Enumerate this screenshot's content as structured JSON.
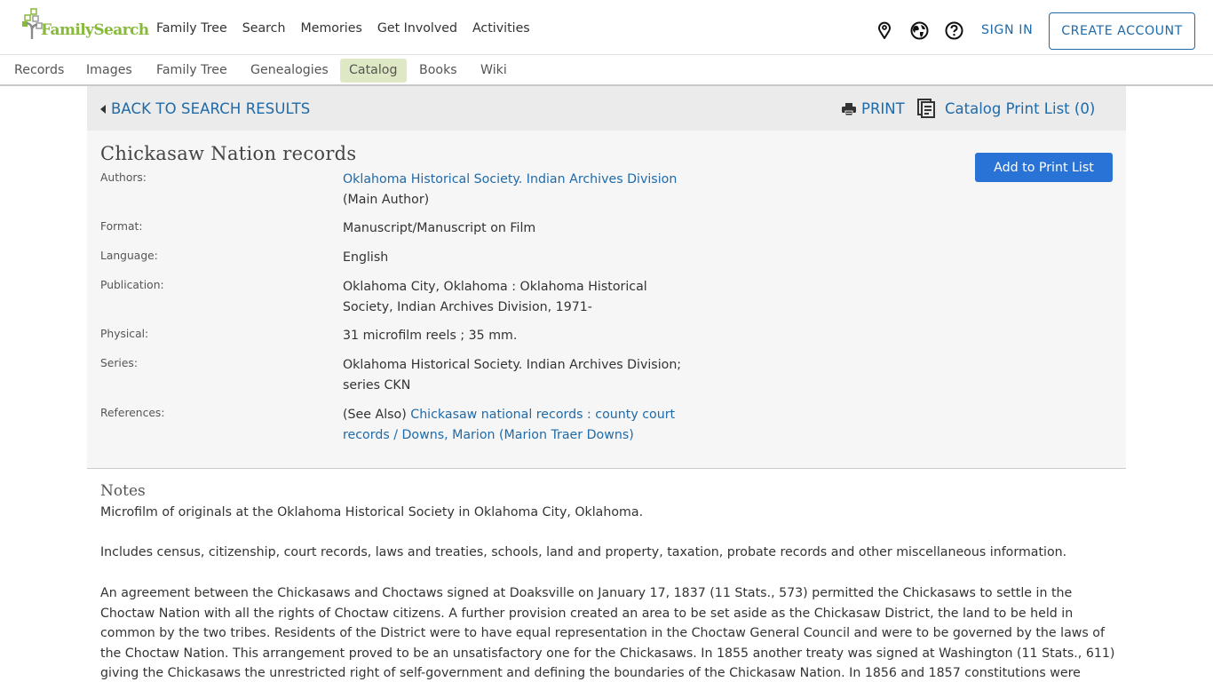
{
  "header": {
    "logo_text": "FamilySearch",
    "nav": [
      "Family Tree",
      "Search",
      "Memories",
      "Get Involved",
      "Activities"
    ],
    "icons": [
      "location-pin-icon",
      "globe-icon",
      "help-icon"
    ],
    "sign_in": "SIGN IN",
    "create_account": "CREATE ACCOUNT"
  },
  "subnav": {
    "items": [
      "Records",
      "Images",
      "Family Tree",
      "Genealogies",
      "Catalog",
      "Books",
      "Wiki"
    ],
    "active": "Catalog"
  },
  "toolbar": {
    "back": "BACK TO SEARCH RESULTS",
    "print": "PRINT",
    "print_list": "Catalog Print List (0)"
  },
  "record": {
    "title": "Chickasaw Nation records",
    "add_button": "Add to Print List",
    "fields": {
      "authors": {
        "label": "Authors:",
        "link": "Oklahoma Historical Society. Indian Archives Division",
        "role": "(Main Author)"
      },
      "format": {
        "label": "Format:",
        "value": "Manuscript/Manuscript on Film"
      },
      "language": {
        "label": "Language:",
        "value": "English"
      },
      "publication": {
        "label": "Publication:",
        "value": "Oklahoma City, Oklahoma : Oklahoma Historical Society, Indian Archives Division, 1971-"
      },
      "physical": {
        "label": "Physical:",
        "value": "31 microfilm reels ; 35 mm."
      },
      "series": {
        "label": "Series:",
        "value": "Oklahoma Historical Society. Indian Archives Division; series CKN"
      },
      "references": {
        "label": "References:",
        "prefix": "(See Also) ",
        "link": "Chickasaw national records : county court records / Downs, Marion (Marion Traer Downs)"
      }
    }
  },
  "notes": {
    "title": "Notes",
    "paragraphs": [
      "Microfilm of originals at the Oklahoma Historical Society in Oklahoma City, Oklahoma.",
      "Includes census, citizenship, court records, laws and treaties, schools, land and property, taxation, probate records and other miscellaneous information.",
      "An agreement between the Chickasaws and Choctaws signed at Doaksville on January 17, 1837 (11 Stats., 573) permitted the Chickasaws to settle in the Choctaw Nation with all the rights of Choctaw citizens. A further provision created an area to be set aside as the Chickasaw District, the land to be held in common by the two tribes. Residents of the District were to have equal representation in the Choctaw General Council and were to be governed by the laws of the Choctaw Nation. This arrangement proved to be an unsatisfactory one for the Chickasaws. In 1855 another treaty was signed at Washington (11 Stats., 611) giving the Chickasaws the unrestricted right of self-government and defining the boundaries of the Chickasaw Nation. In 1856 and 1857 constitutions were"
    ]
  },
  "colors": {
    "link": "#1f6aa8",
    "button": "#2a73d6",
    "brand_green": "#87b93a",
    "active_tab": "#dfe8c4"
  }
}
